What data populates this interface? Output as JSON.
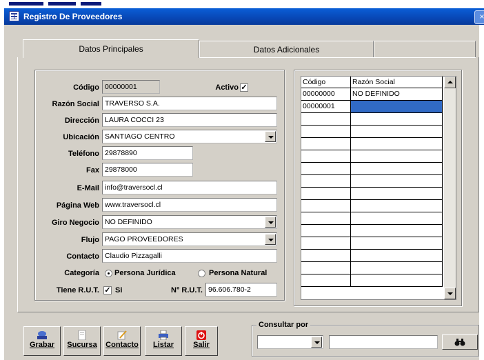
{
  "window": {
    "title": "Registro De Proveedores"
  },
  "tabs": [
    {
      "label": "Datos Principales",
      "active": true
    },
    {
      "label": "Datos Adicionales",
      "active": false
    }
  ],
  "form": {
    "codigo": {
      "label": "Código",
      "value": "00000001"
    },
    "activo": {
      "label": "Activo",
      "checked": true
    },
    "razon_social": {
      "label": "Razón Social",
      "value": "TRAVERSO S.A."
    },
    "direccion": {
      "label": "Dirección",
      "value": "LAURA COCCI 23"
    },
    "ubicacion": {
      "label": "Ubicación",
      "value": "SANTIAGO CENTRO"
    },
    "telefono": {
      "label": "Teléfono",
      "value": "29878890"
    },
    "fax": {
      "label": "Fax",
      "value": "29878000"
    },
    "email": {
      "label": "E-Mail",
      "value": "info@traversocl.cl"
    },
    "pagina_web": {
      "label": "Página Web",
      "value": "www.traversocl.cl"
    },
    "giro_negocio": {
      "label": "Giro Negocio",
      "value": "NO DEFINIDO"
    },
    "flujo": {
      "label": "Flujo",
      "value": "PAGO PROVEEDORES"
    },
    "contacto": {
      "label": "Contacto",
      "value": "Claudio Pizzagalli"
    },
    "categoria": {
      "label": "Categoría",
      "options": [
        "Persona Jurídica",
        "Persona Natural"
      ],
      "selected": "Persona Jurídica"
    },
    "tiene_rut": {
      "label": "Tiene R.U.T.",
      "checked": true,
      "option_label": "Si"
    },
    "nro_rut": {
      "label": "N° R.U.T.",
      "value": "96.606.780-2"
    }
  },
  "grid": {
    "columns": [
      "Código",
      "Razón Social"
    ],
    "rows": [
      {
        "codigo": "00000000",
        "razon_social": "NO DEFINIDO"
      },
      {
        "codigo": "00000001",
        "razon_social": ""
      }
    ]
  },
  "toolbar": {
    "grabar": "Grabar",
    "sucursal": "Sucursa",
    "contacto": "Contacto",
    "listar": "Listar",
    "salir": "Salir"
  },
  "consultar": {
    "label": "Consultar por",
    "field_value": "",
    "search_value": ""
  },
  "colors": {
    "titlebar": "#0847b5",
    "face": "#d4d0c8",
    "selection": "#316ac5"
  },
  "icons": [
    "app-grid-icon",
    "close-icon",
    "disk-icon",
    "document-icon",
    "pencil-icon",
    "printer-icon",
    "power-icon",
    "binoculars-icon"
  ]
}
